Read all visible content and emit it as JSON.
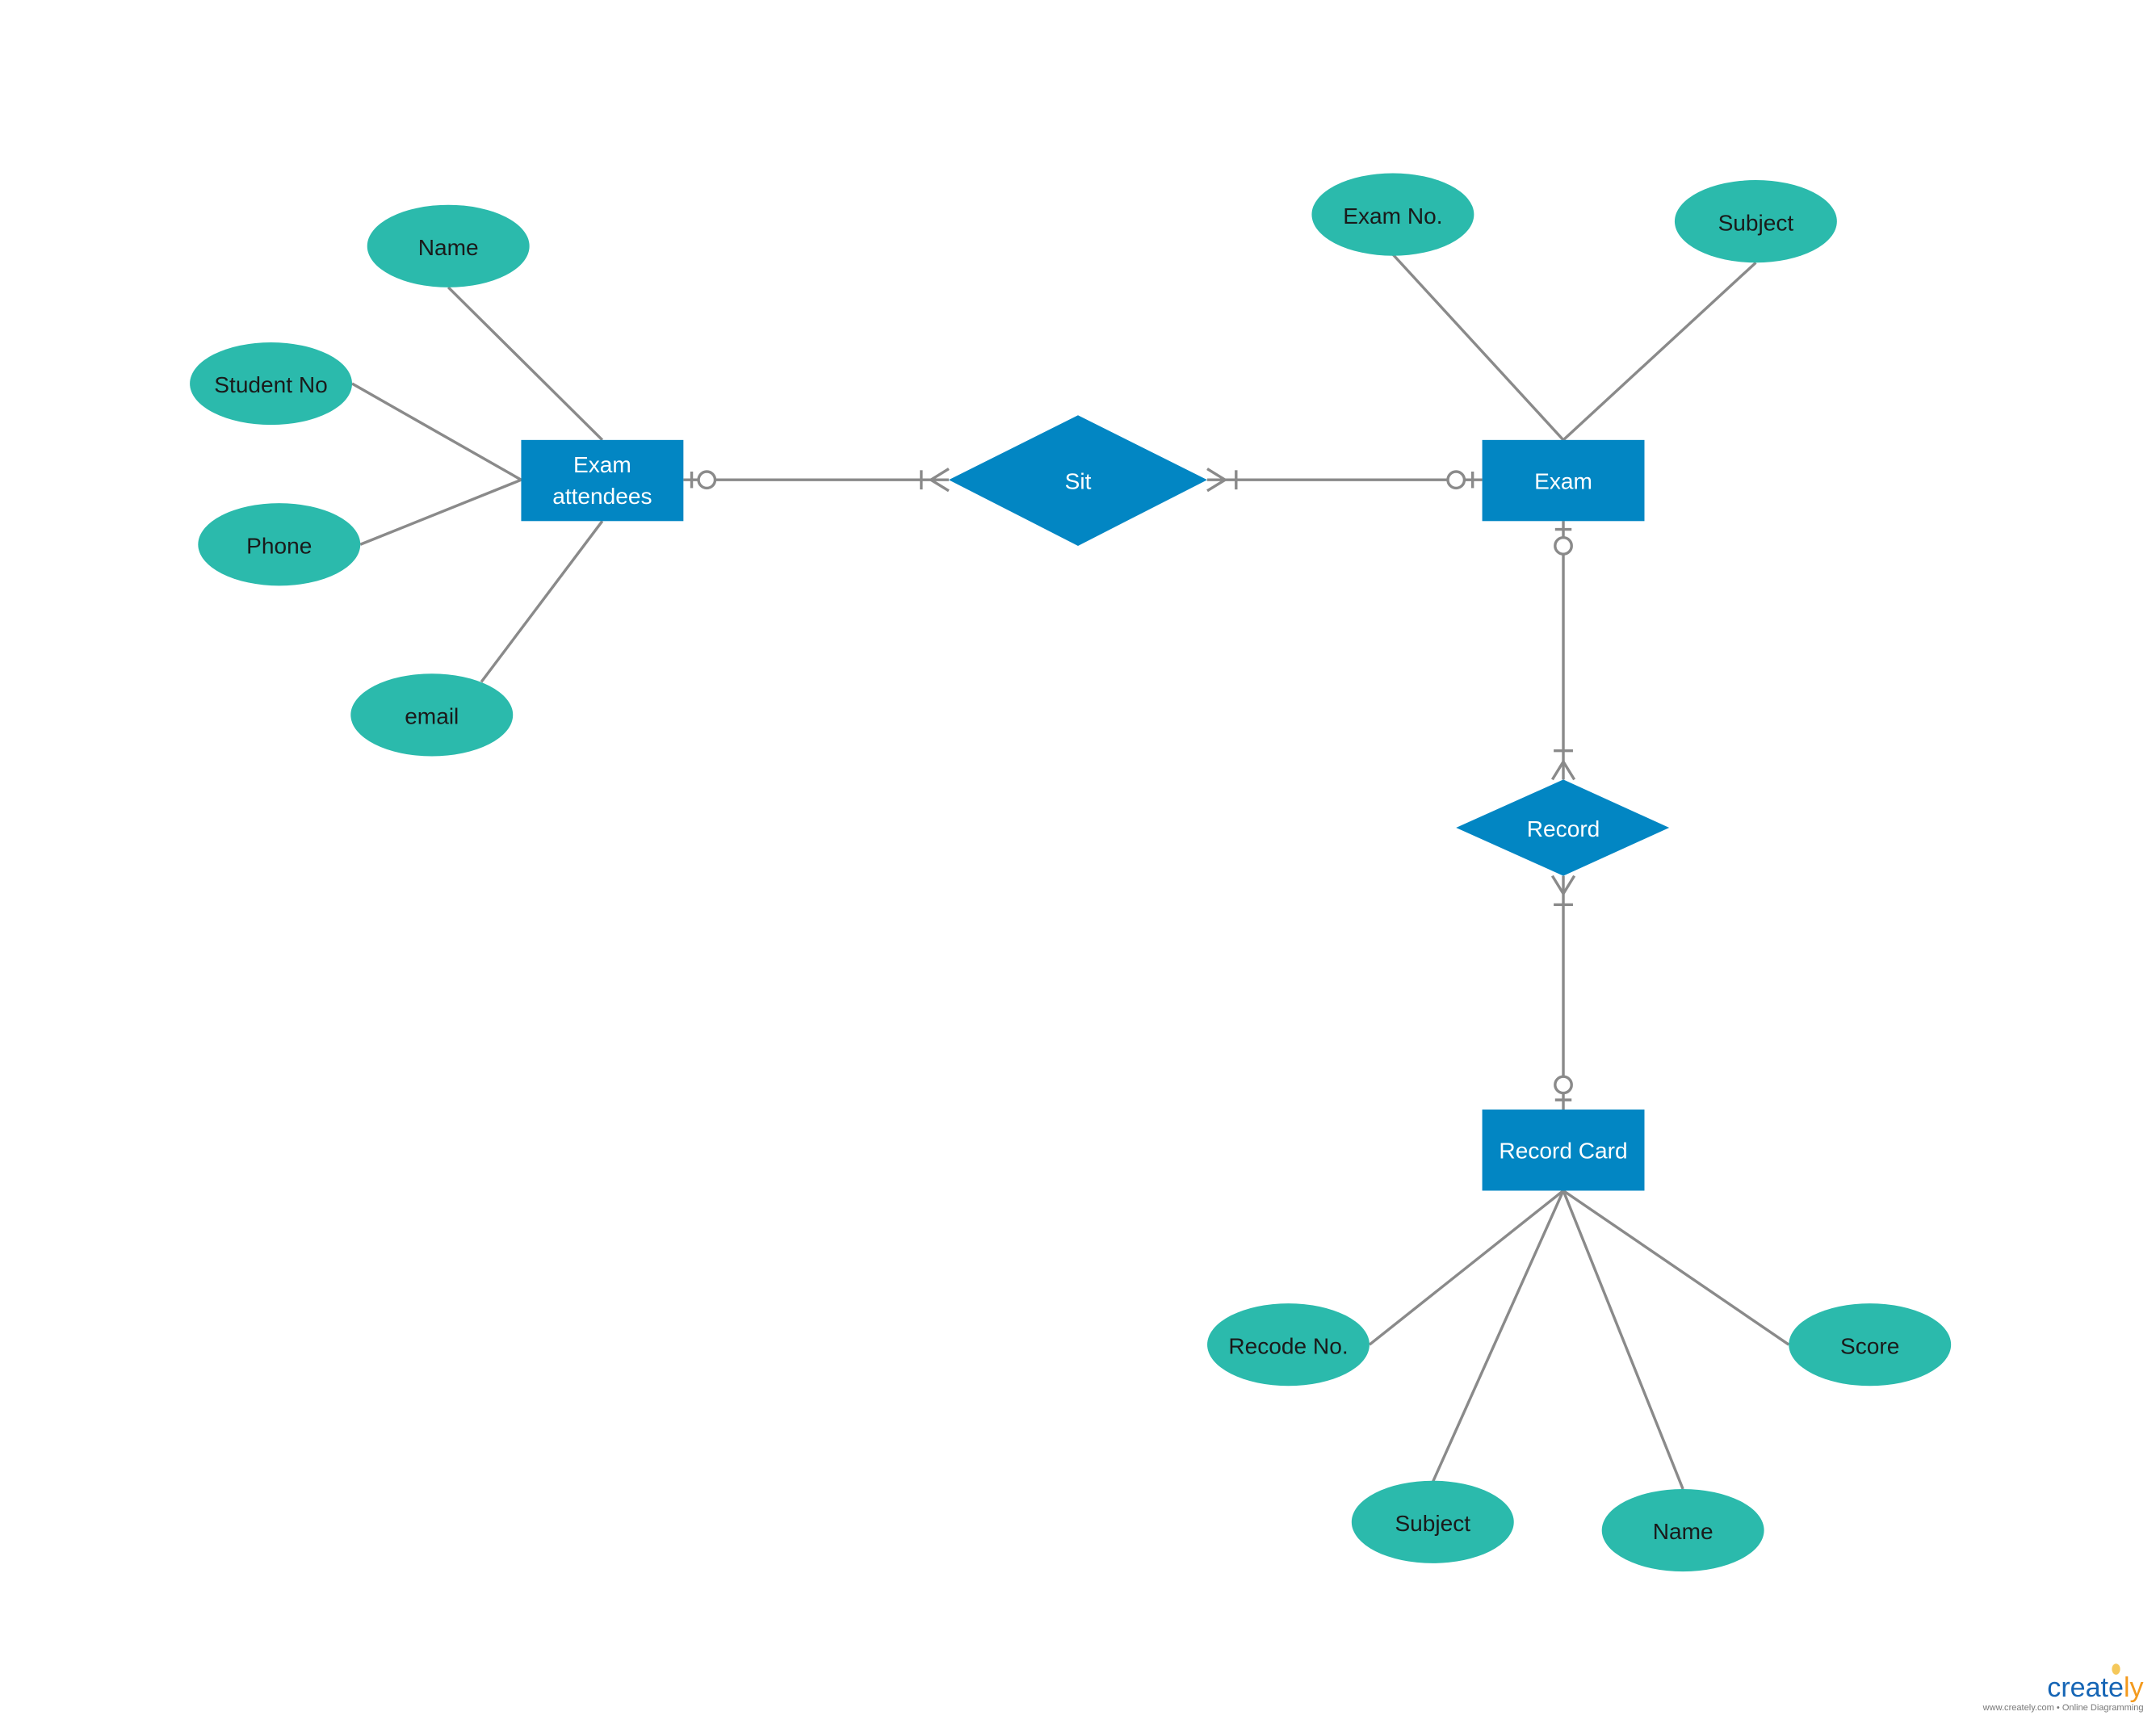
{
  "colors": {
    "entity": "#0286c3",
    "relationship": "#0286c3",
    "attribute": "#2bbaac",
    "connector": "#8a8a8a"
  },
  "entities": {
    "exam_attendees": {
      "line1": "Exam",
      "line2": "attendees"
    },
    "exam": {
      "label": "Exam"
    },
    "record_card": {
      "label": "Record Card"
    }
  },
  "relationships": {
    "sit": {
      "label": "Sit"
    },
    "record": {
      "label": "Record"
    }
  },
  "attributes": {
    "exam_attendees": [
      "Name",
      "Student No",
      "Phone",
      "email"
    ],
    "exam": [
      "Exam No.",
      "Subject"
    ],
    "record_card": [
      "Recode No.",
      "Subject",
      "Name",
      "Score"
    ]
  },
  "connectors": [
    {
      "from": "Exam attendees",
      "to": "Sit",
      "from_end": "zero-or-one",
      "to_end": "one-or-many"
    },
    {
      "from": "Sit",
      "to": "Exam",
      "from_end": "one-or-many",
      "to_end": "zero-or-one"
    },
    {
      "from": "Exam",
      "to": "Record",
      "from_end": "zero-or-one",
      "to_end": "one-or-many"
    },
    {
      "from": "Record",
      "to": "Record Card",
      "from_end": "one-or-many",
      "to_end": "zero-or-one"
    }
  ],
  "watermark": {
    "logo": "creately",
    "tagline": "www.creately.com • Online Diagramming"
  }
}
